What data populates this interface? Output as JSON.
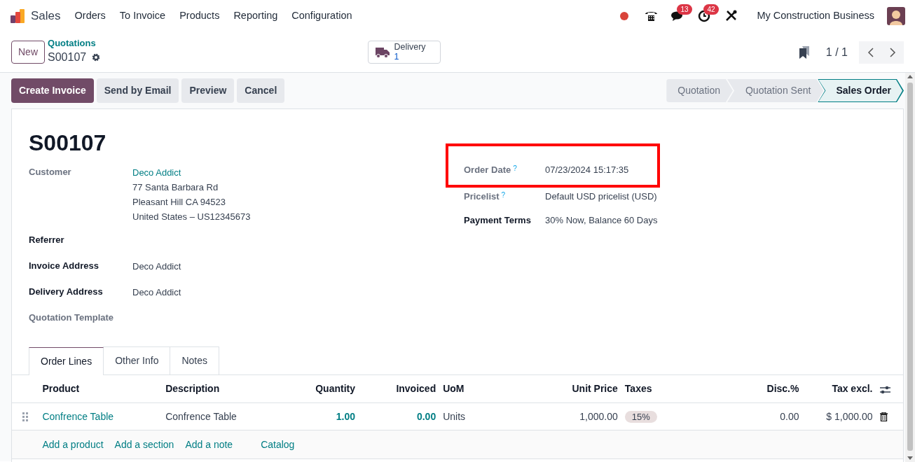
{
  "navbar": {
    "app": "Sales",
    "menu": [
      "Orders",
      "To Invoice",
      "Products",
      "Reporting",
      "Configuration"
    ],
    "systray": [
      {
        "kind": "dot"
      },
      {
        "kind": "phone"
      },
      {
        "kind": "chat",
        "badge": "13"
      },
      {
        "kind": "clock",
        "badge": "42"
      },
      {
        "kind": "tools"
      }
    ],
    "company": "My Construction Business"
  },
  "control_panel": {
    "new_button": "New",
    "breadcrumb": "Quotations",
    "record": "S00107",
    "smart_button": {
      "label": "Delivery",
      "count": "1"
    },
    "pager": "1 / 1"
  },
  "actions": [
    {
      "label": "Create Invoice",
      "kind": "primary"
    },
    {
      "label": "Send by Email",
      "kind": "secondary"
    },
    {
      "label": "Preview",
      "kind": "secondary"
    },
    {
      "label": "Cancel",
      "kind": "secondary"
    }
  ],
  "statusbar": [
    {
      "label": "Quotation",
      "selected": false
    },
    {
      "label": "Quotation Sent",
      "selected": false
    },
    {
      "label": "Sales Order",
      "selected": true
    }
  ],
  "form": {
    "title": "S00107",
    "left_fields": [
      {
        "label": "Customer",
        "muted": true,
        "link": true,
        "values": [
          "Deco Addict",
          "77 Santa Barbara Rd",
          "Pleasant Hill CA 94523",
          "United States – US12345673"
        ]
      },
      {
        "label": "Referrer",
        "muted": false
      },
      {
        "label": "Invoice Address",
        "muted": false,
        "values": [
          "Deco Addict"
        ]
      },
      {
        "label": "Delivery Address",
        "muted": false,
        "values": [
          "Deco Addict"
        ]
      },
      {
        "label": "Quotation Template",
        "muted": true
      }
    ],
    "right_fields": [
      {
        "label": "Order Date",
        "help": "?",
        "muted": true,
        "highlighted": true,
        "value": "07/23/2024 15:17:35"
      },
      {
        "label": "Pricelist",
        "help": "?",
        "muted": true,
        "value": "Default USD pricelist (USD)"
      },
      {
        "label": "Payment Terms",
        "muted": false,
        "value": "30% Now, Balance 60 Days"
      }
    ]
  },
  "tabs": [
    {
      "label": "Order Lines",
      "selected": true
    },
    {
      "label": "Other Info",
      "selected": false
    },
    {
      "label": "Notes",
      "selected": false
    }
  ],
  "table": {
    "columns": [
      "Product",
      "Description",
      "Quantity",
      "Invoiced",
      "UoM",
      "Unit Price",
      "Taxes",
      "Disc.%",
      "Tax excl."
    ],
    "rows": [
      {
        "product": "Confrence Table",
        "description": "Confrence Table",
        "quantity": "1.00",
        "invoiced": "0.00",
        "uom": "Units",
        "unit_price": "1,000.00",
        "taxes": "15%",
        "discount": "0.00",
        "subtotal": "$ 1,000.00"
      }
    ],
    "add_links": [
      "Add a product",
      "Add a section",
      "Add a note",
      "Catalog"
    ]
  }
}
